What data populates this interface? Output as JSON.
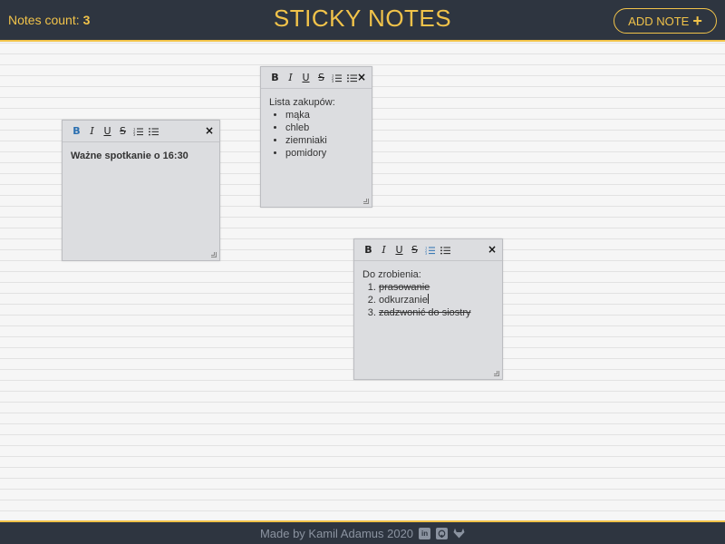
{
  "header": {
    "count_label": "Notes count:",
    "count_value": "3",
    "title": "STICKY NOTES",
    "add_note_label": "ADD NOTE",
    "add_icon": "plus-icon"
  },
  "toolbar": {
    "bold": "B",
    "italic": "I",
    "underline": "U",
    "strike": "S",
    "ordered_list_icon": "ordered-list-icon",
    "bullet_list_icon": "bullet-list-icon",
    "close": "×"
  },
  "notes": [
    {
      "text": "Ważne spotkanie o 16:30",
      "active_tool": "bold"
    },
    {
      "heading": "Lista zakupów:",
      "items": [
        "mąka",
        "chleb",
        "ziemniaki",
        "pomidory"
      ]
    },
    {
      "heading": "Do zrobienia:",
      "items": [
        "prasowanie",
        "odkurzanie",
        "zadzwonić do siostry"
      ],
      "struck": [
        true,
        false,
        true
      ],
      "active_tool": "ordered-list"
    }
  ],
  "footer": {
    "text": "Made by Kamil Adamus 2020",
    "icons": [
      "linkedin-icon",
      "github-icon",
      "gitlab-icon"
    ]
  },
  "colors": {
    "accent": "#f1c34a",
    "bar": "#2e3540",
    "note": "#dcdde0",
    "active_tool": "#2a6fb0"
  }
}
